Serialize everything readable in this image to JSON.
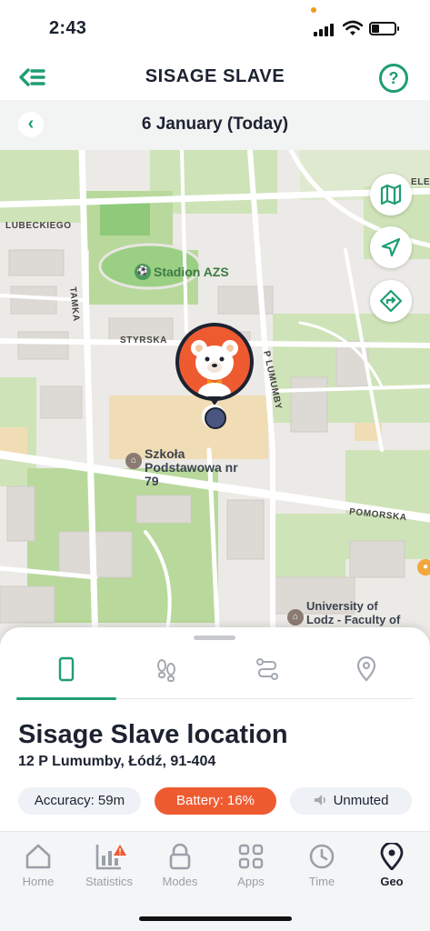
{
  "status_bar": {
    "time": "2:43",
    "battery_level": 0.35
  },
  "header": {
    "title": "SISAGE SLAVE",
    "menu_icon": "back-menu-icon",
    "help_label": "?"
  },
  "date_bar": {
    "back_label": "‹",
    "date": "6 January (Today)"
  },
  "map": {
    "street_labels": [
      "LUBECKIEGO",
      "TAMKA",
      "STYRSKA",
      "P LUMUMBY",
      "POMORSKA",
      "ELE"
    ],
    "pois": [
      "Stadion AZS",
      "Szkoła Podstawowa nr 79",
      "University of Lodz - Faculty of Phil"
    ],
    "controls": [
      "map-layers-icon",
      "locate-arrow-icon",
      "directions-icon"
    ],
    "pin_color": "#ee5b31"
  },
  "sheet": {
    "tabs": [
      {
        "icon": "phone-icon",
        "active": true
      },
      {
        "icon": "footprints-icon",
        "active": false
      },
      {
        "icon": "route-icon",
        "active": false
      },
      {
        "icon": "location-pin-icon",
        "active": false
      }
    ],
    "title": "Sisage Slave location",
    "address": "12 P Lumumby, Łódź, 91-404",
    "accuracy": "Accuracy: 59m",
    "battery": "Battery: 16%",
    "sound": "Unmuted"
  },
  "nav": {
    "items": [
      {
        "label": "Home",
        "icon": "home-icon"
      },
      {
        "label": "Statistics",
        "icon": "statistics-icon"
      },
      {
        "label": "Modes",
        "icon": "lock-icon"
      },
      {
        "label": "Apps",
        "icon": "apps-grid-icon"
      },
      {
        "label": "Time",
        "icon": "clock-icon"
      },
      {
        "label": "Geo",
        "icon": "geo-pin-icon",
        "active": true
      }
    ]
  },
  "colors": {
    "accent": "#1f9d73",
    "dark": "#1c2230",
    "alert": "#ee5b31"
  }
}
